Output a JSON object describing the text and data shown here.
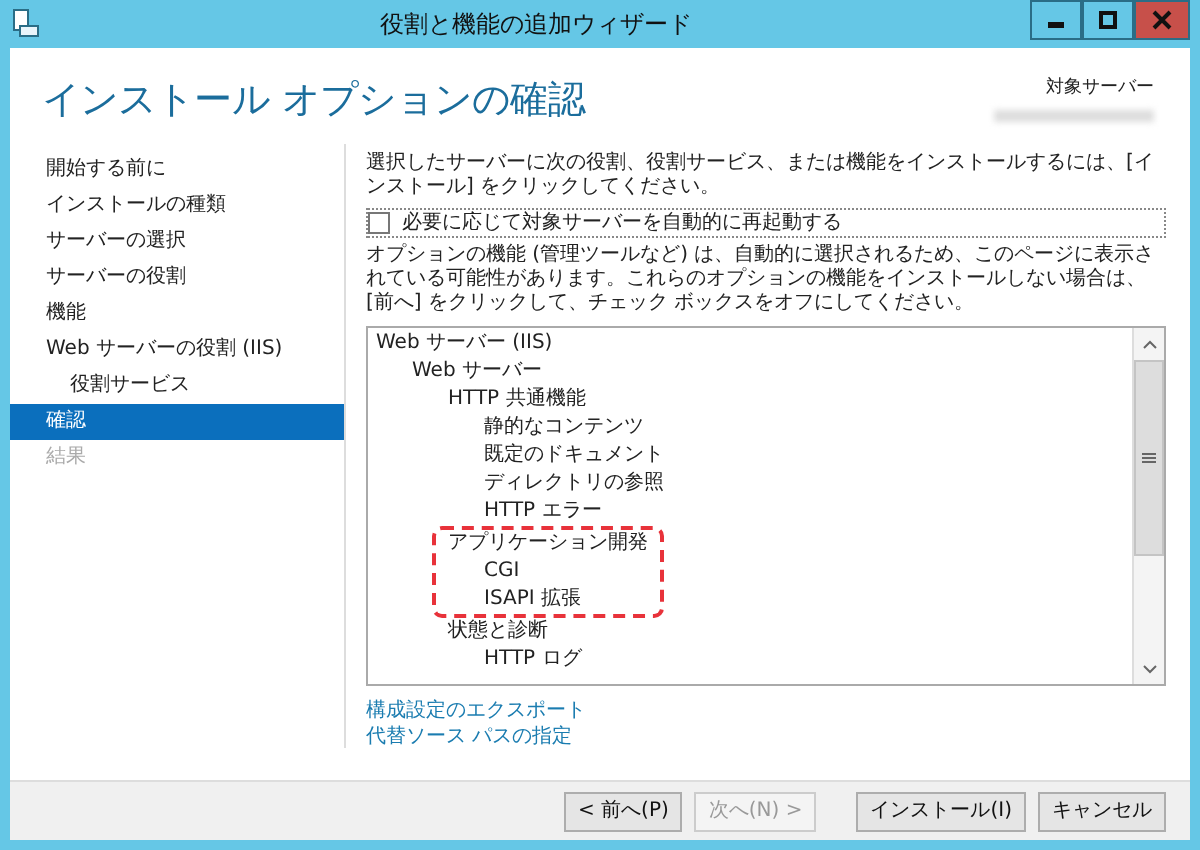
{
  "window": {
    "title": "役割と機能の追加ウィザード"
  },
  "page": {
    "heading": "インストール オプションの確認",
    "target_label": "対象サーバー"
  },
  "sidebar": {
    "items": [
      {
        "label": "開始する前に",
        "selected": false,
        "disabled": false
      },
      {
        "label": "インストールの種類",
        "selected": false,
        "disabled": false
      },
      {
        "label": "サーバーの選択",
        "selected": false,
        "disabled": false
      },
      {
        "label": "サーバーの役割",
        "selected": false,
        "disabled": false
      },
      {
        "label": "機能",
        "selected": false,
        "disabled": false
      },
      {
        "label": "Web サーバーの役割 (IIS)",
        "selected": false,
        "disabled": false,
        "children": [
          {
            "label": "役割サービス",
            "selected": false,
            "disabled": false
          }
        ]
      },
      {
        "label": "確認",
        "selected": true,
        "disabled": false
      },
      {
        "label": "結果",
        "selected": false,
        "disabled": true
      }
    ]
  },
  "content": {
    "instruction": "選択したサーバーに次の役割、役割サービス、または機能をインストールするには、[インストール] をクリックしてください。",
    "restart_checkbox": {
      "label": "必要に応じて対象サーバーを自動的に再起動する",
      "checked": false
    },
    "note": "オプションの機能 (管理ツールなど) は、自動的に選択されるため、このページに表示されている可能性があります。これらのオプションの機能をインストールしない場合は、[前へ] をクリックして、チェック ボックスをオフにしてください。",
    "tree": [
      {
        "label": "Web サーバー (IIS)",
        "children": [
          {
            "label": "Web サーバー",
            "children": [
              {
                "label": "HTTP 共通機能",
                "children": [
                  {
                    "label": "静的なコンテンツ"
                  },
                  {
                    "label": "既定のドキュメント"
                  },
                  {
                    "label": "ディレクトリの参照"
                  },
                  {
                    "label": "HTTP エラー"
                  }
                ]
              },
              {
                "label": "アプリケーション開発",
                "highlighted": true,
                "children": [
                  {
                    "label": "CGI"
                  },
                  {
                    "label": "ISAPI 拡張"
                  }
                ]
              },
              {
                "label": "状態と診断",
                "children": [
                  {
                    "label": "HTTP ログ"
                  }
                ]
              }
            ]
          }
        ]
      }
    ],
    "links": [
      "構成設定のエクスポート",
      "代替ソース パスの指定"
    ]
  },
  "buttons": [
    {
      "label": "< 前へ(P)",
      "disabled": false
    },
    {
      "label": "次へ(N) >",
      "disabled": true
    },
    {
      "label": "インストール(I)",
      "disabled": false
    },
    {
      "label": "キャンセル",
      "disabled": false
    }
  ]
}
